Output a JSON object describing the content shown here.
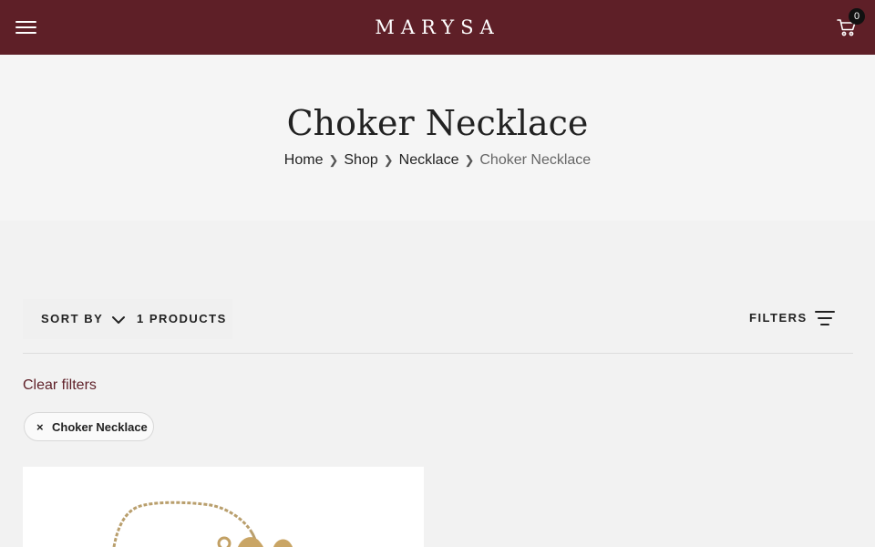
{
  "header": {
    "logo": "MARYSA",
    "cart_count": "0",
    "background": "#5e1f27"
  },
  "hero": {
    "title": "Choker Necklace",
    "breadcrumb": [
      {
        "label": "Home"
      },
      {
        "label": "Shop"
      },
      {
        "label": "Necklace"
      },
      {
        "label": "Choker Necklace"
      }
    ]
  },
  "toolbar": {
    "sort_label": "SORT BY",
    "products_count": "1 PRODUCTS",
    "filters_label": "FILTERS"
  },
  "filters": {
    "clear_label": "Clear filters",
    "active": [
      {
        "label": "Choker Necklace",
        "remove_icon": "×"
      }
    ]
  },
  "colors": {
    "accent": "#5e1f27",
    "page_bg": "#f2f2f2"
  },
  "icons": [
    "hamburger-menu-icon",
    "cart-icon",
    "chevron-down-icon",
    "filter-lines-icon",
    "close-icon",
    "breadcrumb-chevron-icon"
  ]
}
